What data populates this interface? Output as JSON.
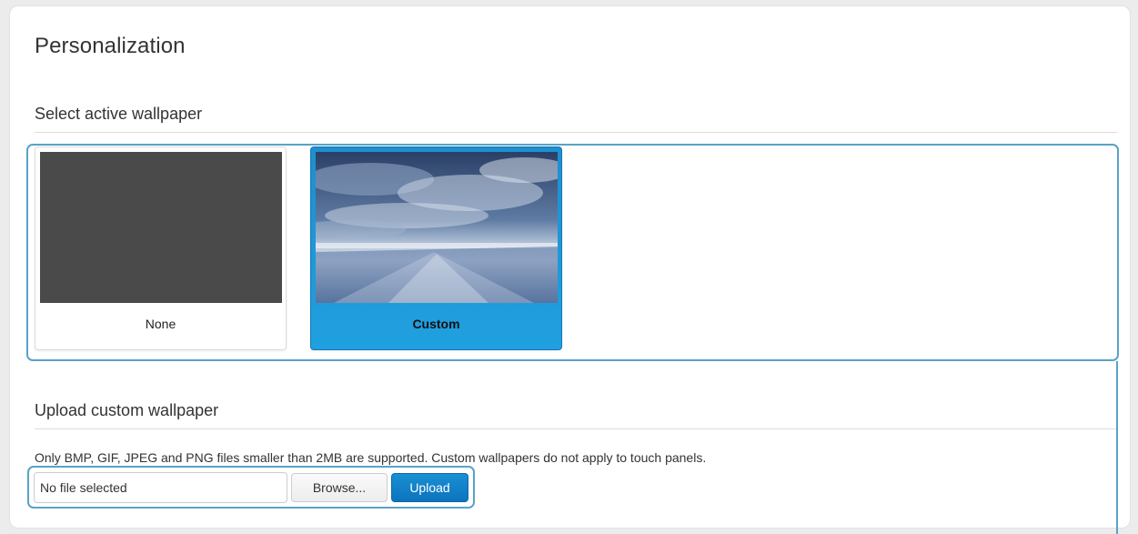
{
  "page": {
    "title": "Personalization"
  },
  "wallpaper": {
    "section_title": "Select active wallpaper",
    "options": [
      {
        "label": "None",
        "selected": false
      },
      {
        "label": "Custom",
        "selected": true
      }
    ]
  },
  "upload": {
    "section_title": "Upload custom wallpaper",
    "hint": "Only BMP, GIF, JPEG and PNG files smaller than 2MB are supported. Custom wallpapers do not apply to touch panels.",
    "file_value": "No file selected",
    "browse_label": "Browse...",
    "upload_label": "Upload"
  },
  "colors": {
    "accent": "#1e8fcf",
    "highlight": "#5aa2c8",
    "upload_button": "#0c74be"
  }
}
